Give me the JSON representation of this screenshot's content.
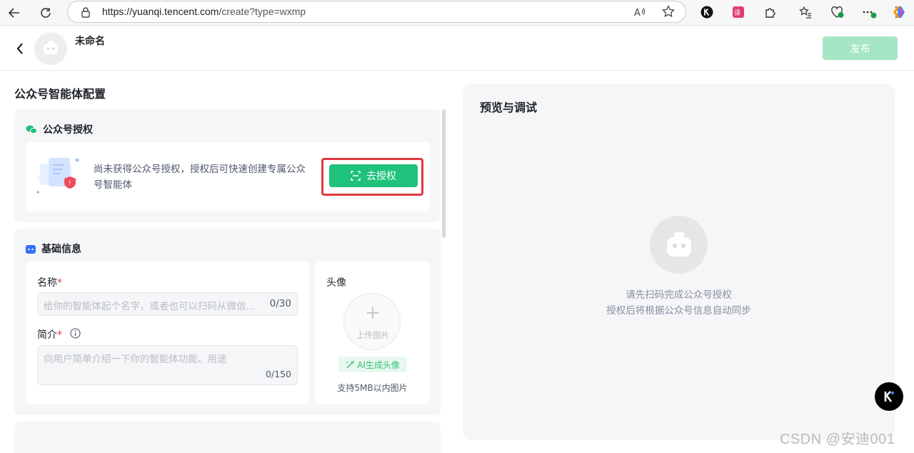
{
  "browser": {
    "url_host": "https://yuanqi.tencent.com",
    "url_path": "/create?type=wxmp"
  },
  "header": {
    "title": "未命名",
    "publish_label": "发布"
  },
  "config": {
    "section_title": "公众号智能体配置",
    "auth_card": {
      "title": "公众号授权",
      "description": "尚未获得公众号授权，授权后可快速创建专属公众号智能体",
      "button_label": "去授权"
    },
    "basic_card": {
      "title": "基础信息",
      "name_label": "名称",
      "name_placeholder": "给你的智能体起个名字，或者也可以扫码从微信...",
      "name_count": "0/30",
      "intro_label": "简介",
      "intro_placeholder": "向用户简单介绍一下你的智能体功能、用途",
      "intro_count": "0/150",
      "avatar_label": "头像",
      "upload_label": "上传图片",
      "ai_avatar_label": "AI生成头像",
      "upload_hint": "支持5MB以内图片",
      "required_mark": "*"
    }
  },
  "preview": {
    "title": "预览与调试",
    "message_line1": "请先扫码完成公众号授权",
    "message_line2": "授权后将根据公众号信息自动同步"
  },
  "watermark": "CSDN @安迪001",
  "colors": {
    "accent": "#1ec27b",
    "highlight": "#e0393e",
    "publish_disabled": "#a7e6c4"
  }
}
